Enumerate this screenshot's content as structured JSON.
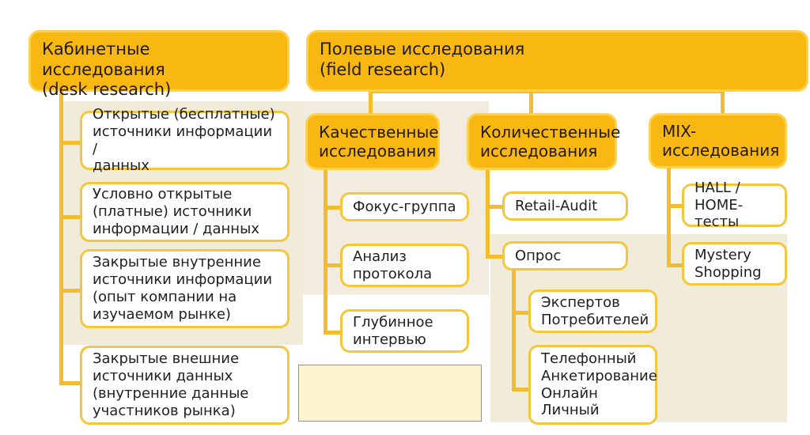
{
  "diagram": {
    "title_left": "Кабинетные исследования\n(desk research)",
    "title_right": "Полевые исследования\n(field research)",
    "colors": {
      "header_fill": "#F8B711",
      "header_border": "#FBD14D",
      "leaf_fill": "#FFFFFF",
      "leaf_border": "#F4C63A",
      "connector": "#F2BC2E",
      "panel_tint": "#EFE7D3",
      "placeholder_fill": "#FDF3CF",
      "placeholder_border": "#8C9196",
      "page_background": "#FFFFFF",
      "text": "#1F1F1F"
    }
  },
  "desk_research": {
    "header": "Кабинетные исследования\n(desk research)",
    "items": [
      "Открытые (бесплатные)\nисточники информации /\nданных",
      "Условно открытые\n(платные) источники\nинформации / данных",
      "Закрытые внутренние\nисточники информации\n(опыт компании на\nизучаемом рынке)",
      "Закрытые внешние\nисточники данных\n(внутренние данные\nучастников рынка)"
    ]
  },
  "field_research": {
    "header": "Полевые исследования\n(field research)",
    "branches": [
      {
        "header": "Качественные\nисследования",
        "items": [
          "Фокус-группа",
          "Анализ\nпротокола",
          "Глубинное\nинтервью"
        ]
      },
      {
        "header": "Количественные\nисследования",
        "items": [
          "Retail-Audit",
          "Опрос"
        ],
        "sub_items": [
          "Экспертов\nПотребителей",
          "Телефонный\nАнкетирование\nОнлайн\nЛичный"
        ]
      },
      {
        "header": "MIX-\nисследования",
        "items": [
          "HALL / HOME-\nтесты",
          "Mystery\nShopping"
        ]
      }
    ]
  },
  "placeholder_box": {
    "label": ""
  }
}
